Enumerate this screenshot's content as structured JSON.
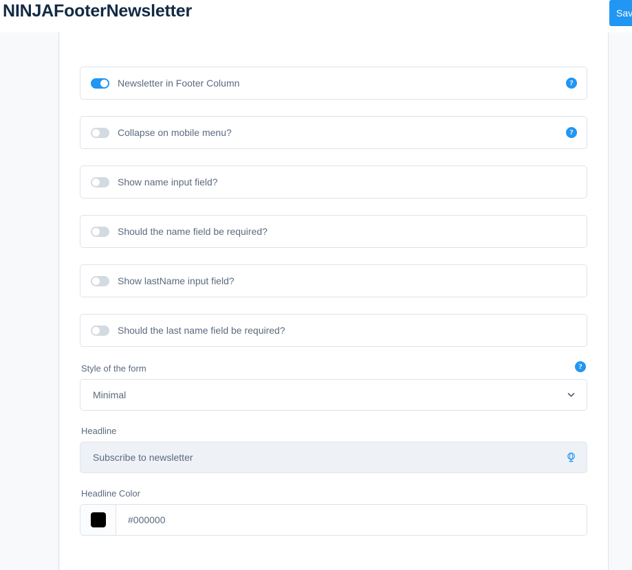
{
  "header": {
    "title": "NINJAFooterNewsletter",
    "save_label": "Save"
  },
  "icons": {
    "help": "?",
    "help_name": "help-icon",
    "chevron_down": "chevron-down-icon",
    "globe": "translate-globe-icon"
  },
  "colors": {
    "accent": "#2196f3",
    "title": "#122a43",
    "label": "#5b6b7f",
    "border": "#dde3ea",
    "panel_bg": "#ffffff",
    "page_bg": "#f7f9fb",
    "input_filled_bg": "#eef1f6",
    "toggle_off": "#d4dae2"
  },
  "toggles": [
    {
      "label": "Newsletter in Footer Column",
      "on": true,
      "help": true
    },
    {
      "label": "Collapse on mobile menu?",
      "on": false,
      "help": true
    },
    {
      "label": "Show name input field?",
      "on": false,
      "help": false
    },
    {
      "label": "Should the name field be required?",
      "on": false,
      "help": false
    },
    {
      "label": "Show lastName input field?",
      "on": false,
      "help": false
    },
    {
      "label": "Should the last name field be required?",
      "on": false,
      "help": false
    }
  ],
  "style_field": {
    "label": "Style of the form",
    "value": "Minimal",
    "options": [
      "Minimal"
    ],
    "help": true
  },
  "headline_field": {
    "label": "Headline",
    "value": "Subscribe to newsletter"
  },
  "headline_color_field": {
    "label": "Headline Color",
    "value": "#000000",
    "swatch": "#000000"
  }
}
